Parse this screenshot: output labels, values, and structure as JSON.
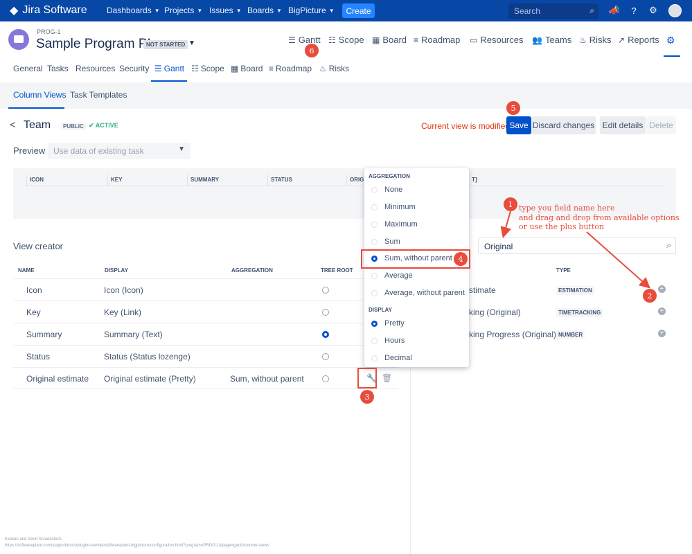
{
  "topnav": {
    "product": "Jira Software",
    "items": [
      "Dashboards",
      "Projects",
      "Issues",
      "Boards",
      "BigPicture"
    ],
    "create_label": "Create",
    "search_placeholder": "Search"
  },
  "project": {
    "key": "PROG-1",
    "title": "Sample Program PI",
    "status": "NOT STARTED",
    "tabs": [
      "Gantt",
      "Scope",
      "Board",
      "Roadmap",
      "Resources",
      "Teams",
      "Risks",
      "Reports"
    ]
  },
  "subtabs": [
    "General",
    "Tasks",
    "Resources",
    "Security",
    "Gantt",
    "Scope",
    "Board",
    "Roadmap",
    "Risks"
  ],
  "content_tabs": [
    "Column Views",
    "Task Templates"
  ],
  "view": {
    "name": "Team",
    "visibility": "PUBLIC",
    "state": "ACTIVE",
    "modified_text": "Current view is modified",
    "save_label": "Save",
    "discard_label": "Discard changes",
    "edit_label": "Edit details",
    "delete_label": "Delete"
  },
  "preview": {
    "label": "Preview",
    "select_placeholder": "Use data of existing task",
    "columns": [
      "ICON",
      "KEY",
      "SUMMARY",
      "STATUS",
      "ORIGI",
      "T]"
    ]
  },
  "view_creator": {
    "title": "View creator",
    "headers": [
      "NAME",
      "DISPLAY",
      "AGGREGATION",
      "TREE ROOT"
    ],
    "rows": [
      {
        "name": "Icon",
        "display": "Icon (Icon)",
        "aggregation": "",
        "tree_root": false
      },
      {
        "name": "Key",
        "display": "Key (Link)",
        "aggregation": "",
        "tree_root": false
      },
      {
        "name": "Summary",
        "display": "Summary (Text)",
        "aggregation": "",
        "tree_root": true
      },
      {
        "name": "Status",
        "display": "Status (Status lozenge)",
        "aggregation": "",
        "tree_root": false
      },
      {
        "name": "Original estimate",
        "display": "Original estimate (Pretty)",
        "aggregation": "Sum, without parent",
        "tree_root": false
      }
    ]
  },
  "available_fields": {
    "search_value": "Original",
    "type_header": "TYPE",
    "rows": [
      {
        "name": "stimate",
        "type": "ESTIMATION"
      },
      {
        "name": "king (Original)",
        "type": "TIMETRACKING"
      },
      {
        "name": "king Progress (Original)",
        "type": "NUMBER"
      }
    ]
  },
  "dropdown": {
    "aggregation_header": "AGGREGATION",
    "aggregation_options": [
      "None",
      "Minimum",
      "Maximum",
      "Sum",
      "Sum, without parent",
      "Average",
      "Average, without parent"
    ],
    "aggregation_selected": "Sum, without parent",
    "display_header": "DISPLAY",
    "display_options": [
      "Pretty",
      "Hours",
      "Decimal"
    ],
    "display_selected": "Pretty"
  },
  "annotations": {
    "numbers": [
      "1",
      "2",
      "3",
      "4",
      "5",
      "6"
    ],
    "note": "type you field name here\nand drag and drop from available options\nor use the plus button",
    "color": "#e74c3c"
  },
  "footer": "Explain and Send Screenshots\nhttps://softwareplant.com/support/docs/plugins/servlet/softwareplant-bigpicture/configuration.html?program=PROG-1&page=gantt/column-views",
  "colors": {
    "nav": "#0747a6",
    "primary": "#0052cc",
    "warning": "#de350b",
    "success": "#36b37e"
  }
}
